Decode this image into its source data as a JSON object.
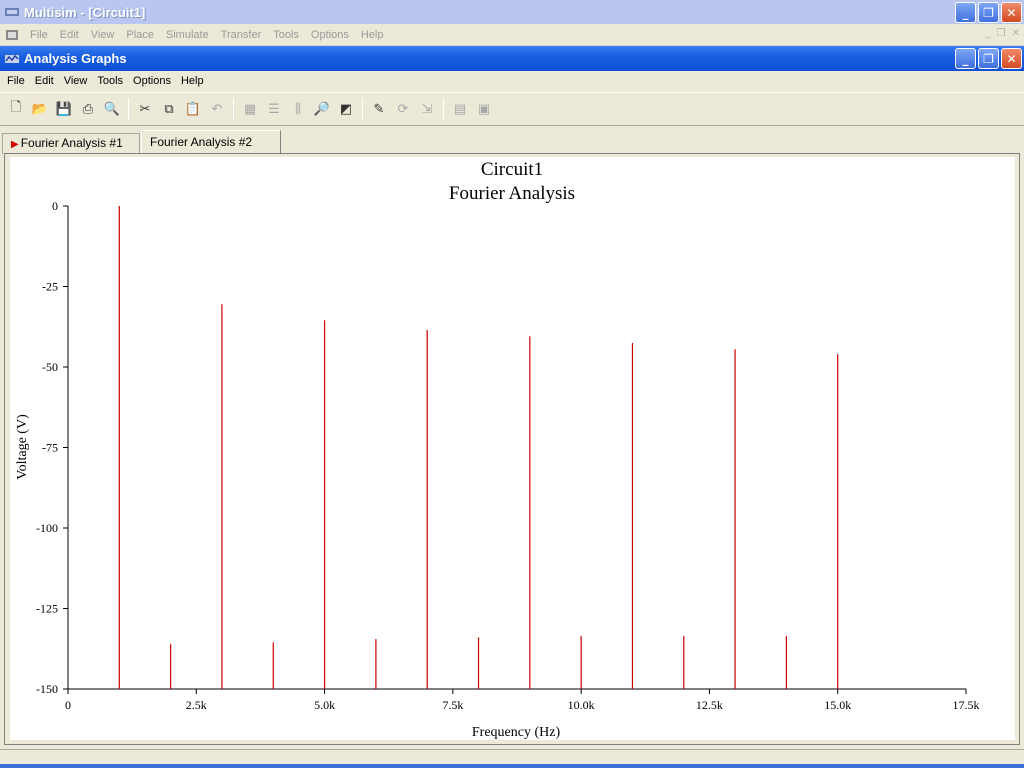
{
  "app": {
    "title": "Multisim - [Circuit1]",
    "menu": [
      "File",
      "Edit",
      "View",
      "Place",
      "Simulate",
      "Transfer",
      "Tools",
      "Options",
      "Help"
    ]
  },
  "window_controls": {
    "minimize": "_",
    "restore": "❐",
    "close": "✕"
  },
  "inner_window": {
    "title": "Analysis Graphs",
    "menu": [
      "File",
      "Edit",
      "View",
      "Tools",
      "Options",
      "Help"
    ]
  },
  "toolbar": {
    "buttons": [
      {
        "name": "new-icon",
        "glyph": "🗋",
        "enabled": true
      },
      {
        "name": "open-icon",
        "glyph": "📂",
        "enabled": true
      },
      {
        "name": "save-icon",
        "glyph": "💾",
        "enabled": true
      },
      {
        "name": "print-icon",
        "glyph": "⎙",
        "enabled": true
      },
      {
        "name": "print-preview-icon",
        "glyph": "🔍",
        "enabled": true
      },
      {
        "name": "cut-icon",
        "glyph": "✂",
        "enabled": true
      },
      {
        "name": "copy-icon",
        "glyph": "⧉",
        "enabled": true
      },
      {
        "name": "paste-icon",
        "glyph": "📋",
        "enabled": false
      },
      {
        "name": "undo-icon",
        "glyph": "↶",
        "enabled": false
      },
      {
        "name": "grid-icon",
        "glyph": "▦",
        "enabled": false
      },
      {
        "name": "legend-icon",
        "glyph": "☰",
        "enabled": false
      },
      {
        "name": "cursors-icon",
        "glyph": "⫼",
        "enabled": false
      },
      {
        "name": "zoom-icon",
        "glyph": "🔎",
        "enabled": false
      },
      {
        "name": "reverse-colors-icon",
        "glyph": "◩",
        "enabled": true
      },
      {
        "name": "properties-icon",
        "glyph": "✎",
        "enabled": true
      },
      {
        "name": "overlay-icon",
        "glyph": "⟳",
        "enabled": false
      },
      {
        "name": "select-trace-icon",
        "glyph": "⇲",
        "enabled": false
      },
      {
        "name": "export-excel-icon",
        "glyph": "▤",
        "enabled": false
      },
      {
        "name": "export-mathcad-icon",
        "glyph": "▣",
        "enabled": false
      }
    ]
  },
  "tabs": [
    {
      "label": "Fourier Analysis #1",
      "active": false,
      "marker": "▶"
    },
    {
      "label": "Fourier Analysis #2",
      "active": true
    }
  ],
  "colors": {
    "trace": "#cc0000",
    "axis": "#000000",
    "plot_bg": "#ffffff"
  },
  "chart_data": {
    "type": "bar",
    "title": "Circuit1",
    "subtitle": "Fourier Analysis",
    "xlabel": "Frequency (Hz)",
    "ylabel": "Voltage (V)",
    "xlim": [
      0,
      17500
    ],
    "ylim": [
      -150,
      0
    ],
    "x_ticks": [
      {
        "value": 0,
        "label": "0"
      },
      {
        "value": 2500,
        "label": "2.5k"
      },
      {
        "value": 5000,
        "label": "5.0k"
      },
      {
        "value": 7500,
        "label": "7.5k"
      },
      {
        "value": 10000,
        "label": "10.0k"
      },
      {
        "value": 12500,
        "label": "12.5k"
      },
      {
        "value": 15000,
        "label": "15.0k"
      },
      {
        "value": 17500,
        "label": "17.5k"
      }
    ],
    "y_ticks": [
      {
        "value": 0,
        "label": "0"
      },
      {
        "value": -25,
        "label": "-25"
      },
      {
        "value": -50,
        "label": "-50"
      },
      {
        "value": -75,
        "label": "-75"
      },
      {
        "value": -100,
        "label": "-100"
      },
      {
        "value": -125,
        "label": "-125"
      },
      {
        "value": -150,
        "label": "-150"
      }
    ],
    "grid": false,
    "series": [
      {
        "x": [
          1000,
          2000,
          3000,
          4000,
          5000,
          6000,
          7000,
          8000,
          9000,
          10000,
          11000,
          12000,
          13000,
          14000,
          15000
        ],
        "values": [
          0,
          -136,
          -30.5,
          -135.5,
          -35.5,
          -134.5,
          -38.5,
          -134,
          -40.5,
          -133.5,
          -42.5,
          -133.5,
          -44.5,
          -133.5,
          -46
        ]
      }
    ]
  }
}
